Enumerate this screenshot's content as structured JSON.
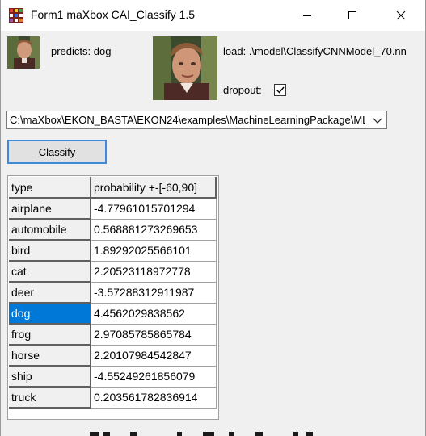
{
  "window": {
    "title": "Form1 maXbox CAI_Classify 1.5",
    "controls": {
      "minimize": "minimize",
      "maximize": "maximize",
      "close": "close"
    }
  },
  "prediction": {
    "label": "predicts: dog"
  },
  "model": {
    "load_label": "load: .\\model\\ClassifyCNNModel_70.nn"
  },
  "dropout": {
    "label": "dropout:",
    "checked": true
  },
  "path_select": {
    "value": "C:\\maXbox\\EKON_BASTA\\EKON24\\examples\\MachineLearningPackage\\ML"
  },
  "classify_button": {
    "label": "Classify"
  },
  "grid": {
    "headers": [
      "type",
      "probability +-[-60,90]"
    ],
    "selected_row": 5,
    "rows": [
      {
        "type": "airplane",
        "probability": "-4.77961015701294"
      },
      {
        "type": "automobile",
        "probability": "0.568881273269653"
      },
      {
        "type": "bird",
        "probability": "1.89292025566101"
      },
      {
        "type": "cat",
        "probability": "2.20523118972778"
      },
      {
        "type": "deer",
        "probability": "-3.57288312911987"
      },
      {
        "type": "dog",
        "probability": "4.4562029838562"
      },
      {
        "type": "frog",
        "probability": "2.97085785865784"
      },
      {
        "type": "horse",
        "probability": "2.20107984542847"
      },
      {
        "type": "ship",
        "probability": "-4.55249261856079"
      },
      {
        "type": "truck",
        "probability": "0.203561782836914"
      }
    ]
  },
  "colors": {
    "selection": "#0078d7",
    "button_border": "#3c8ad8"
  }
}
